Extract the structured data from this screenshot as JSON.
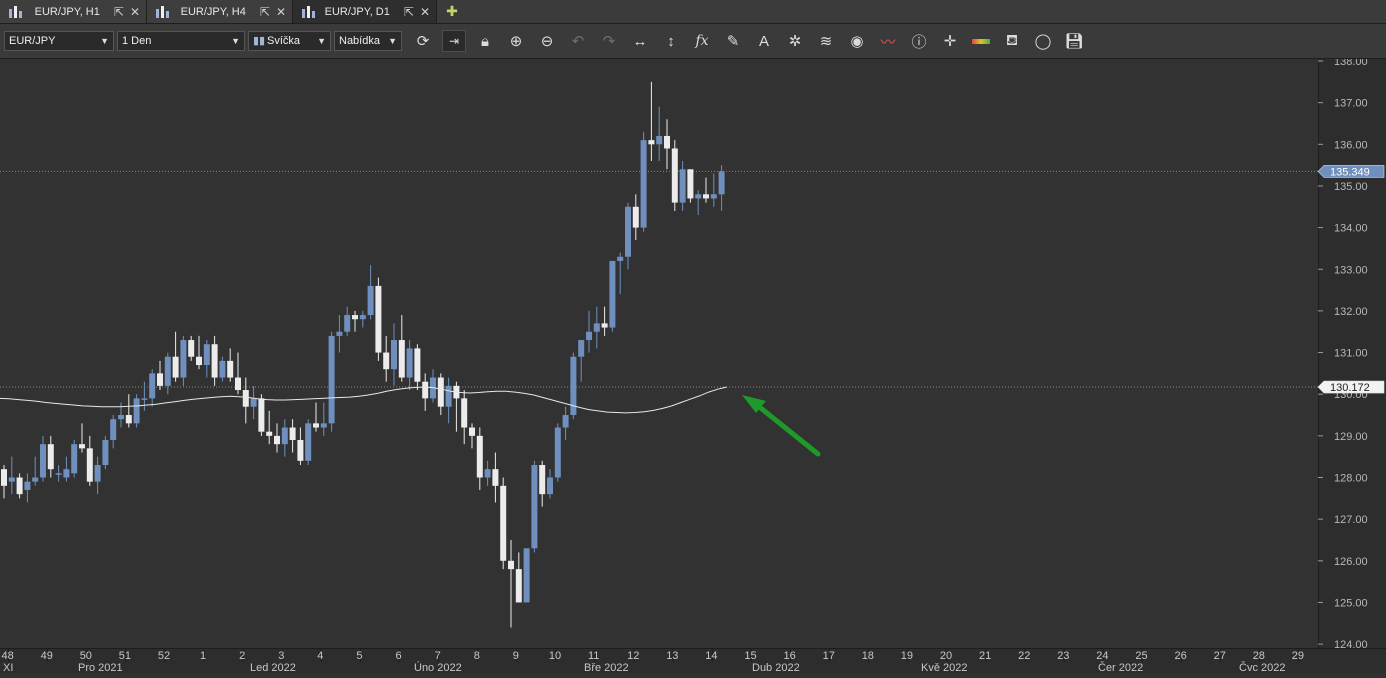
{
  "tabs": [
    {
      "label": "EUR/JPY, H1",
      "active": false
    },
    {
      "label": "EUR/JPY, H4",
      "active": false
    },
    {
      "label": "EUR/JPY, D1",
      "active": true
    }
  ],
  "toolbar": {
    "instrument": "EUR/JPY",
    "period": "1 Den",
    "chart_type": "Svíčka",
    "offer_side": "Nabídka",
    "icons": [
      "refresh-icon",
      "shift-chart-icon",
      "lock-icon",
      "zoom-in-icon",
      "zoom-out-icon",
      "undo-icon",
      "redo-icon",
      "horizontal-arrows-icon",
      "vertical-arrows-icon",
      "function-icon",
      "pencil-icon",
      "text-tool-icon",
      "sparkle-icon",
      "layers-icon",
      "eye-icon",
      "indicator-icon",
      "info-icon",
      "crosshair-icon",
      "color-bar-icon",
      "paint-bucket-icon",
      "circle-icon",
      "save-icon"
    ]
  },
  "chart_data": {
    "type": "candlestick",
    "y_range": [
      124.0,
      138.0
    ],
    "y_ticks": [
      "138.00",
      "137.00",
      "136.00",
      "135.00",
      "134.00",
      "133.00",
      "132.00",
      "131.00",
      "130.00",
      "129.00",
      "128.00",
      "127.00",
      "126.00",
      "125.00",
      "124.00"
    ],
    "price_label": "135.349",
    "price_value": 135.349,
    "ma_label": "130.172",
    "ma_value": 130.172,
    "week_ticks": [
      "48",
      "49",
      "50",
      "51",
      "52",
      "1",
      "2",
      "3",
      "4",
      "5",
      "6",
      "7",
      "8",
      "9",
      "10",
      "11",
      "12",
      "13",
      "14",
      "15",
      "16",
      "17",
      "18",
      "19",
      "20",
      "21",
      "22",
      "23",
      "24",
      "25",
      "26",
      "27",
      "28",
      "29"
    ],
    "month_labels": [
      "XI",
      "Pro 2021",
      "Led 2022",
      "Úno 2022",
      "Bře 2022",
      "Dub 2022",
      "Kvě 2022",
      "Čer 2022",
      "Čvc 2022"
    ],
    "colors": {
      "up": "#6f8fbe",
      "down": "#ececec",
      "ma": "#e8e8e8",
      "arrow": "#1e9a2a",
      "grid": "#2a2a2a",
      "axis_bg": "#2d2d2d"
    },
    "candles": [
      [
        128.2,
        128.3,
        127.5,
        127.8
      ],
      [
        127.9,
        128.5,
        127.6,
        128.0
      ],
      [
        128.0,
        128.1,
        127.5,
        127.6
      ],
      [
        127.7,
        128.1,
        127.4,
        127.9
      ],
      [
        127.9,
        128.5,
        127.8,
        128.0
      ],
      [
        128.0,
        129.0,
        127.9,
        128.8
      ],
      [
        128.8,
        129.0,
        128.0,
        128.2
      ],
      [
        128.1,
        128.3,
        127.9,
        128.1
      ],
      [
        128.0,
        128.5,
        127.9,
        128.2
      ],
      [
        128.1,
        128.9,
        128.0,
        128.8
      ],
      [
        128.8,
        129.3,
        128.6,
        128.7
      ],
      [
        128.7,
        129.0,
        127.8,
        127.9
      ],
      [
        127.9,
        128.5,
        127.6,
        128.3
      ],
      [
        128.3,
        129.0,
        128.2,
        128.9
      ],
      [
        128.9,
        129.5,
        128.7,
        129.4
      ],
      [
        129.4,
        129.8,
        129.2,
        129.5
      ],
      [
        129.5,
        130.0,
        129.2,
        129.3
      ],
      [
        129.3,
        130.0,
        129.2,
        129.9
      ],
      [
        129.9,
        130.3,
        129.6,
        129.9
      ],
      [
        129.9,
        130.6,
        129.7,
        130.5
      ],
      [
        130.5,
        130.8,
        130.1,
        130.2
      ],
      [
        130.2,
        131.0,
        130.0,
        130.9
      ],
      [
        130.9,
        131.5,
        130.3,
        130.4
      ],
      [
        130.4,
        131.4,
        130.2,
        131.3
      ],
      [
        131.3,
        131.4,
        130.8,
        130.9
      ],
      [
        130.9,
        131.4,
        130.6,
        130.7
      ],
      [
        130.7,
        131.3,
        130.4,
        131.2
      ],
      [
        131.2,
        131.4,
        130.2,
        130.4
      ],
      [
        130.4,
        130.9,
        130.3,
        130.8
      ],
      [
        130.8,
        131.1,
        130.3,
        130.4
      ],
      [
        130.4,
        131.0,
        130.0,
        130.1
      ],
      [
        130.1,
        130.4,
        129.3,
        129.7
      ],
      [
        129.7,
        130.2,
        129.4,
        129.9
      ],
      [
        129.9,
        130.0,
        129.0,
        129.1
      ],
      [
        129.1,
        129.6,
        128.8,
        129.0
      ],
      [
        129.0,
        129.3,
        128.6,
        128.8
      ],
      [
        128.8,
        129.4,
        128.5,
        129.2
      ],
      [
        129.2,
        129.4,
        128.6,
        128.9
      ],
      [
        128.9,
        129.2,
        128.3,
        128.4
      ],
      [
        128.4,
        129.4,
        128.3,
        129.3
      ],
      [
        129.3,
        129.8,
        129.1,
        129.2
      ],
      [
        129.2,
        129.8,
        129.0,
        129.3
      ],
      [
        129.3,
        131.5,
        129.1,
        131.4
      ],
      [
        131.4,
        131.9,
        131.0,
        131.5
      ],
      [
        131.5,
        132.1,
        131.4,
        131.9
      ],
      [
        131.9,
        132.0,
        131.5,
        131.8
      ],
      [
        131.8,
        132.0,
        131.6,
        131.9
      ],
      [
        131.9,
        133.1,
        131.8,
        132.6
      ],
      [
        132.6,
        132.8,
        130.8,
        131.0
      ],
      [
        131.0,
        131.4,
        130.3,
        130.6
      ],
      [
        130.6,
        131.7,
        130.2,
        131.3
      ],
      [
        131.3,
        131.9,
        130.3,
        130.4
      ],
      [
        130.4,
        131.3,
        130.1,
        131.1
      ],
      [
        131.1,
        131.2,
        130.1,
        130.3
      ],
      [
        130.3,
        130.5,
        129.6,
        129.9
      ],
      [
        129.9,
        130.6,
        129.8,
        130.4
      ],
      [
        130.4,
        130.5,
        129.5,
        129.7
      ],
      [
        129.7,
        130.4,
        129.3,
        130.2
      ],
      [
        130.2,
        130.3,
        129.1,
        129.9
      ],
      [
        129.9,
        130.1,
        128.8,
        129.2
      ],
      [
        129.2,
        129.3,
        128.7,
        129.0
      ],
      [
        129.0,
        129.2,
        127.7,
        128.0
      ],
      [
        128.0,
        128.4,
        127.8,
        128.2
      ],
      [
        128.2,
        128.6,
        127.4,
        127.8
      ],
      [
        127.8,
        128.0,
        125.8,
        126.0
      ],
      [
        126.0,
        126.5,
        124.4,
        125.8
      ],
      [
        125.8,
        126.2,
        125.0,
        125.0
      ],
      [
        125.0,
        126.3,
        125.0,
        126.3
      ],
      [
        126.3,
        128.4,
        126.2,
        128.3
      ],
      [
        128.3,
        128.4,
        127.3,
        127.6
      ],
      [
        127.6,
        128.2,
        127.5,
        128.0
      ],
      [
        128.0,
        129.3,
        127.9,
        129.2
      ],
      [
        129.2,
        129.7,
        128.9,
        129.5
      ],
      [
        129.5,
        131.0,
        129.4,
        130.9
      ],
      [
        130.9,
        131.3,
        130.3,
        131.3
      ],
      [
        131.3,
        132.0,
        131.0,
        131.5
      ],
      [
        131.5,
        132.1,
        131.1,
        131.7
      ],
      [
        131.7,
        132.1,
        131.4,
        131.6
      ],
      [
        131.6,
        133.2,
        131.5,
        133.2
      ],
      [
        133.2,
        133.4,
        132.4,
        133.3
      ],
      [
        133.3,
        134.6,
        133.0,
        134.5
      ],
      [
        134.5,
        134.8,
        133.7,
        134.0
      ],
      [
        134.0,
        136.3,
        133.9,
        136.1
      ],
      [
        136.1,
        137.5,
        135.6,
        136.0
      ],
      [
        136.0,
        136.9,
        135.6,
        136.2
      ],
      [
        136.2,
        136.6,
        135.4,
        135.9
      ],
      [
        135.9,
        136.1,
        134.4,
        134.6
      ],
      [
        134.6,
        135.6,
        134.4,
        135.4
      ],
      [
        135.4,
        135.4,
        134.6,
        134.7
      ],
      [
        134.7,
        134.9,
        134.3,
        134.8
      ],
      [
        134.8,
        135.2,
        134.6,
        134.7
      ],
      [
        134.7,
        135.3,
        134.5,
        134.8
      ],
      [
        134.8,
        135.5,
        134.4,
        135.349
      ]
    ],
    "ma": [
      129.9,
      129.89,
      129.87,
      129.85,
      129.83,
      129.8,
      129.78,
      129.76,
      129.74,
      129.72,
      129.71,
      129.7,
      129.7,
      129.7,
      129.71,
      129.72,
      129.74,
      129.76,
      129.79,
      129.82,
      129.85,
      129.88,
      129.9,
      129.92,
      129.94,
      129.95,
      129.94,
      129.92,
      129.89,
      129.87,
      129.86,
      129.86,
      129.87,
      129.88,
      129.89,
      129.9,
      129.91,
      129.92,
      129.93,
      129.95,
      129.98,
      130.02,
      130.07,
      130.11,
      130.14,
      130.16,
      130.17,
      130.16,
      130.12,
      130.07,
      130.04,
      130.03,
      130.04,
      130.06,
      130.07,
      130.07,
      130.05,
      130.02,
      129.98,
      129.92,
      129.86,
      129.8,
      129.74,
      129.68,
      129.63,
      129.6,
      129.57,
      129.56,
      129.55,
      129.56,
      129.58,
      129.61,
      129.66,
      129.72,
      129.8,
      129.88,
      129.96,
      130.05,
      130.12,
      130.172
    ]
  }
}
